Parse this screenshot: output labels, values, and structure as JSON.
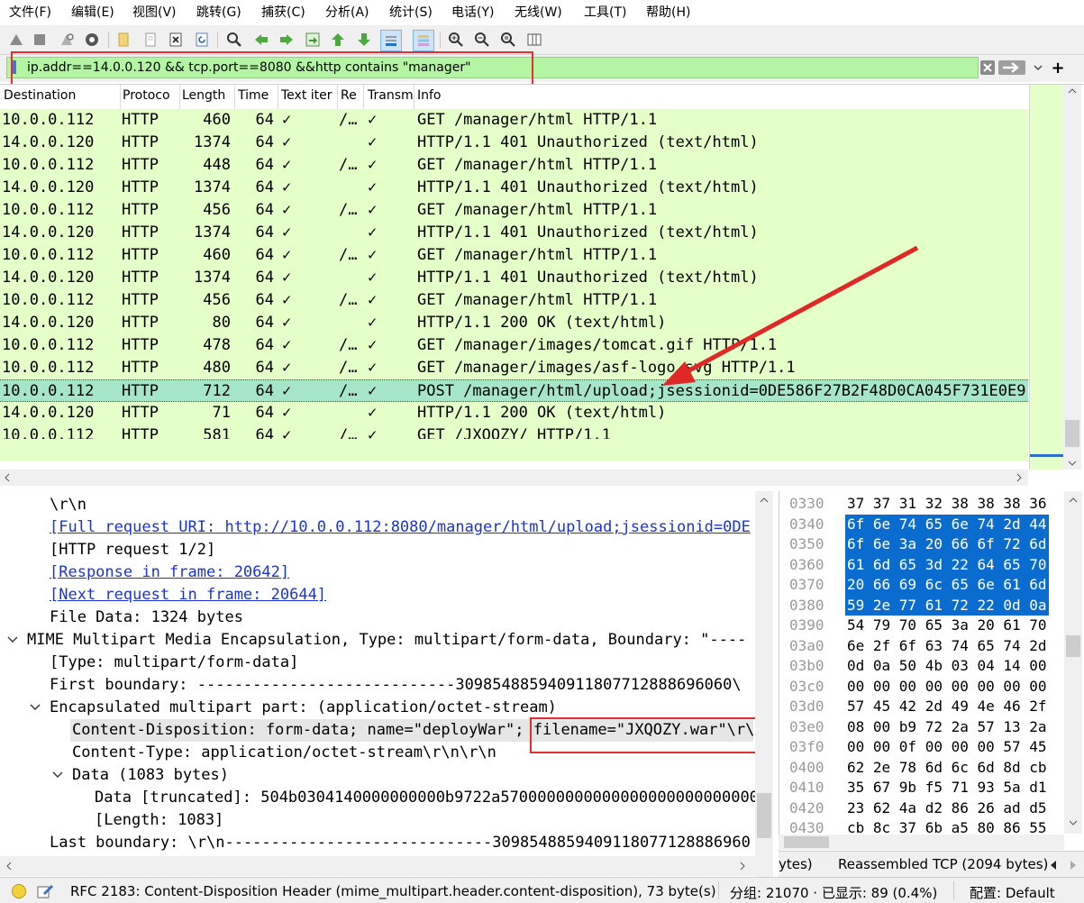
{
  "menu": [
    "文件(F)",
    "编辑(E)",
    "视图(V)",
    "跳转(G)",
    "捕获(C)",
    "分析(A)",
    "统计(S)",
    "电话(Y)",
    "无线(W)",
    "工具(T)",
    "帮助(H)"
  ],
  "toolbar_icons": [
    "shark-fin-start-icon",
    "stop-icon",
    "restart-icon",
    "capture-options-icon",
    "open-file-icon",
    "save-file-icon",
    "close-file-icon",
    "reload-icon",
    "find-packet-icon",
    "go-back-icon",
    "go-forward-icon",
    "go-to-packet-icon",
    "first-packet-icon",
    "last-packet-icon",
    "autoscroll-icon",
    "colorize-icon",
    "zoom-in-icon",
    "zoom-out-icon",
    "zoom-reset-icon",
    "resize-columns-icon"
  ],
  "filter": {
    "text": "ip.addr==14.0.0.120 && tcp.port==8080 &&http contains \"manager\"",
    "bg_color": "#b4f5a3"
  },
  "packet_list": {
    "columns": [
      "Destination",
      "Protoco",
      "Length",
      "Time",
      "Text iter",
      "Re",
      "Transm",
      "Info"
    ],
    "rows": [
      {
        "dst": "10.0.0.112",
        "proto": "HTTP",
        "len": "460",
        "time": "64",
        "text": "✓",
        "re": "/…",
        "tr": "✓",
        "info": "GET /manager/html HTTP/1.1",
        "selected": false
      },
      {
        "dst": "14.0.0.120",
        "proto": "HTTP",
        "len": "1374",
        "time": "64",
        "text": "✓",
        "re": "",
        "tr": "✓",
        "info": "HTTP/1.1 401 Unauthorized  (text/html)",
        "selected": false
      },
      {
        "dst": "10.0.0.112",
        "proto": "HTTP",
        "len": "448",
        "time": "64",
        "text": "✓",
        "re": "/…",
        "tr": "✓",
        "info": "GET /manager/html HTTP/1.1",
        "selected": false
      },
      {
        "dst": "14.0.0.120",
        "proto": "HTTP",
        "len": "1374",
        "time": "64",
        "text": "✓",
        "re": "",
        "tr": "✓",
        "info": "HTTP/1.1 401 Unauthorized  (text/html)",
        "selected": false
      },
      {
        "dst": "10.0.0.112",
        "proto": "HTTP",
        "len": "456",
        "time": "64",
        "text": "✓",
        "re": "/…",
        "tr": "✓",
        "info": "GET /manager/html HTTP/1.1",
        "selected": false
      },
      {
        "dst": "14.0.0.120",
        "proto": "HTTP",
        "len": "1374",
        "time": "64",
        "text": "✓",
        "re": "",
        "tr": "✓",
        "info": "HTTP/1.1 401 Unauthorized  (text/html)",
        "selected": false
      },
      {
        "dst": "10.0.0.112",
        "proto": "HTTP",
        "len": "460",
        "time": "64",
        "text": "✓",
        "re": "/…",
        "tr": "✓",
        "info": "GET /manager/html HTTP/1.1",
        "selected": false
      },
      {
        "dst": "14.0.0.120",
        "proto": "HTTP",
        "len": "1374",
        "time": "64",
        "text": "✓",
        "re": "",
        "tr": "✓",
        "info": "HTTP/1.1 401 Unauthorized  (text/html)",
        "selected": false
      },
      {
        "dst": "10.0.0.112",
        "proto": "HTTP",
        "len": "456",
        "time": "64",
        "text": "✓",
        "re": "/…",
        "tr": "✓",
        "info": "GET /manager/html HTTP/1.1",
        "selected": false
      },
      {
        "dst": "14.0.0.120",
        "proto": "HTTP",
        "len": "80",
        "time": "64",
        "text": "✓",
        "re": "",
        "tr": "✓",
        "info": "HTTP/1.1 200 OK  (text/html)",
        "selected": false
      },
      {
        "dst": "10.0.0.112",
        "proto": "HTTP",
        "len": "478",
        "time": "64",
        "text": "✓",
        "re": "/…",
        "tr": "✓",
        "info": "GET /manager/images/tomcat.gif HTTP/1.1",
        "selected": false
      },
      {
        "dst": "10.0.0.112",
        "proto": "HTTP",
        "len": "480",
        "time": "64",
        "text": "✓",
        "re": "/…",
        "tr": "✓",
        "info": "GET /manager/images/asf-logo.svg HTTP/1.1",
        "selected": false
      },
      {
        "dst": "10.0.0.112",
        "proto": "HTTP",
        "len": "712",
        "time": "64",
        "text": "✓",
        "re": "/…",
        "tr": "✓",
        "info": "POST /manager/html/upload;jsessionid=0DE586F27B2F48D0CA045F731E0E9",
        "selected": true
      },
      {
        "dst": "14.0.0.120",
        "proto": "HTTP",
        "len": "71",
        "time": "64",
        "text": "✓",
        "re": "",
        "tr": "✓",
        "info": "HTTP/1.1 200 OK  (text/html)",
        "selected": false
      },
      {
        "dst": "10.0.0.112",
        "proto": "HTTP",
        "len": "581",
        "time": "64",
        "text": "✓",
        "re": "/…",
        "tr": "✓",
        "info": "GET /JXQOZY/ HTTP/1.1",
        "selected": false
      }
    ]
  },
  "details": [
    {
      "text": "\\r\\n",
      "indent": 2,
      "kind": "plain",
      "toggle": ""
    },
    {
      "text": "[Full request URI: http://10.0.0.112:8080/manager/html/upload;jsessionid=0DE",
      "indent": 2,
      "kind": "link",
      "toggle": ""
    },
    {
      "text": "[HTTP request 1/2]",
      "indent": 2,
      "kind": "plain",
      "toggle": ""
    },
    {
      "text": "[Response in frame: 20642]",
      "indent": 2,
      "kind": "link",
      "toggle": ""
    },
    {
      "text": "[Next request in frame: 20644]",
      "indent": 2,
      "kind": "link",
      "toggle": ""
    },
    {
      "text": "File Data: 1324 bytes",
      "indent": 2,
      "kind": "plain",
      "toggle": ""
    },
    {
      "text": "MIME Multipart Media Encapsulation, Type: multipart/form-data, Boundary: \"----",
      "indent": 1,
      "kind": "plain",
      "toggle": "expanded"
    },
    {
      "text": "[Type: multipart/form-data]",
      "indent": 2,
      "kind": "plain",
      "toggle": ""
    },
    {
      "text": "First boundary: ----------------------------309854885940911807712888696060\\",
      "indent": 2,
      "kind": "plain",
      "toggle": ""
    },
    {
      "text": "Encapsulated multipart part:  (application/octet-stream)",
      "indent": 2,
      "kind": "plain",
      "toggle": "expanded"
    },
    {
      "text": "Content-Disposition: form-data; name=\"deployWar\"; filename=\"JXQOZY.war\"\\r\\",
      "indent": 3,
      "kind": "highlight",
      "toggle": ""
    },
    {
      "text": "Content-Type: application/octet-stream\\r\\n\\r\\n",
      "indent": 3,
      "kind": "plain",
      "toggle": ""
    },
    {
      "text": "Data (1083 bytes)",
      "indent": 3,
      "kind": "plain",
      "toggle": "expanded"
    },
    {
      "text": "Data [truncated]: 504b0304140000000000b9722a5700000000000000000000000000",
      "indent": 4,
      "kind": "plain",
      "toggle": ""
    },
    {
      "text": "[Length: 1083]",
      "indent": 4,
      "kind": "plain",
      "toggle": ""
    },
    {
      "text": "Last boundary: \\r\\n-----------------------------309854885940911807712888696​0",
      "indent": 2,
      "kind": "plain",
      "toggle": ""
    }
  ],
  "bytes": [
    {
      "off": "0330",
      "hex": "37 37 31 32 38 38 38 36",
      "sel": false
    },
    {
      "off": "0340",
      "hex": "6f 6e 74 65 6e 74 2d 44",
      "sel": true
    },
    {
      "off": "0350",
      "hex": "6f 6e 3a 20 66 6f 72 6d",
      "sel": true
    },
    {
      "off": "0360",
      "hex": "61 6d 65 3d 22 64 65 70",
      "sel": true
    },
    {
      "off": "0370",
      "hex": "20 66 69 6c 65 6e 61 6d",
      "sel": true
    },
    {
      "off": "0380",
      "hex": "59 2e 77 61 72 22 0d 0a",
      "sel": true
    },
    {
      "off": "0390",
      "hex": "54 79 70 65 3a 20 61 70",
      "sel": false
    },
    {
      "off": "03a0",
      "hex": "6e 2f 6f 63 74 65 74 2d",
      "sel": false
    },
    {
      "off": "03b0",
      "hex": "0d 0a 50 4b 03 04 14 00",
      "sel": false
    },
    {
      "off": "03c0",
      "hex": "00 00 00 00 00 00 00 00",
      "sel": false
    },
    {
      "off": "03d0",
      "hex": "57 45 42 2d 49 4e 46 2f",
      "sel": false
    },
    {
      "off": "03e0",
      "hex": "08 00 b9 72 2a 57 13 2a",
      "sel": false
    },
    {
      "off": "03f0",
      "hex": "00 00 0f 00 00 00 57 45",
      "sel": false
    },
    {
      "off": "0400",
      "hex": "62 2e 78 6d 6c 6d 8d cb",
      "sel": false
    },
    {
      "off": "0410",
      "hex": "35 67 9b f5 71 93 5a d1",
      "sel": false
    },
    {
      "off": "0420",
      "hex": "23 62 4a d2 86 26 ad d5",
      "sel": false
    },
    {
      "off": "0430",
      "hex": "cb 8c 37 6b a5 80 86 55",
      "sel": false
    }
  ],
  "bytes_tabs": [
    "ytes)",
    "Reassembled TCP (2094 bytes)"
  ],
  "status": {
    "field_info": "RFC 2183: Content-Disposition Header (mime_multipart.header.content-disposition), 73 byte(s)",
    "packets": "分组: 21070 · 已显示: 89 (0.4%)",
    "profile": "配置: Default"
  },
  "colors": {
    "row_bg": "#e4ffc7",
    "row_selected": "#a5e6c9",
    "link": "#1a33d9",
    "byte_highlight": "#0a6ccf",
    "annotation": "#e03030"
  }
}
